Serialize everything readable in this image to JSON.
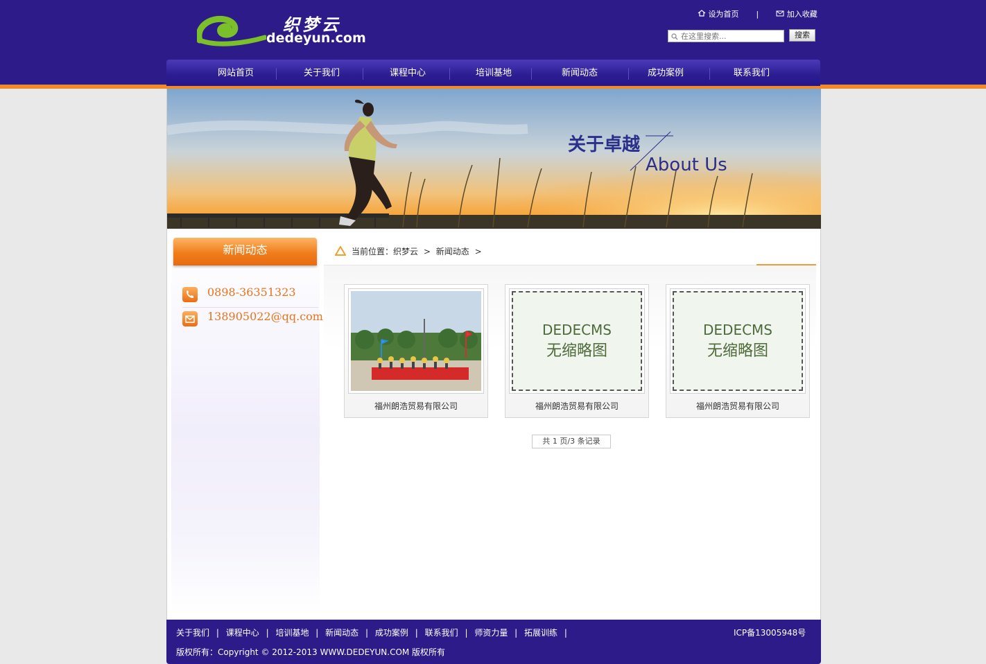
{
  "site": {
    "logo_cn": "织梦云",
    "logo_en": "dedeyun.com",
    "top_links": {
      "home": "设为首页",
      "separator": "|",
      "favorite": "加入收藏"
    },
    "search": {
      "placeholder": "在这里搜索...",
      "button": "搜索"
    }
  },
  "nav": [
    "网站首页",
    "关于我们",
    "课程中心",
    "培训基地",
    "新闻动态",
    "成功案例",
    "联系我们"
  ],
  "banner": {
    "title_cn": "关于卓越",
    "title_en": "About Us"
  },
  "sidebar": {
    "heading": "新闻动态",
    "phone": "0898-36351323",
    "email": "138905022@qq.com"
  },
  "breadcrumb": {
    "prefix": "当前位置：",
    "home": "织梦云",
    "arrow1": ">",
    "section": "新闻动态",
    "arrow2": ">"
  },
  "items": [
    {
      "title": "福州朗浩贸易有限公司",
      "thumb_type": "photo"
    },
    {
      "title": "福州朗浩贸易有限公司",
      "thumb_type": "placeholder",
      "placeholder_line1": "DEDECMS",
      "placeholder_line2": "无缩略图"
    },
    {
      "title": "福州朗浩贸易有限公司",
      "thumb_type": "placeholder",
      "placeholder_line1": "DEDECMS",
      "placeholder_line2": "无缩略图"
    }
  ],
  "pager": "共 1 页/3 条记录",
  "footer": {
    "links": [
      "关于我们",
      "课程中心",
      "培训基地",
      "新闻动态",
      "成功案例",
      "联系我们",
      "师资力量",
      "拓展训练"
    ],
    "link_sep": "|",
    "icp": "ICP备13005948号",
    "copyright": "版权所有：Copyright © 2012-2013 WWW.DEDEYUN.COM 版权所有"
  },
  "colors": {
    "brand_purple": "#2e1b8a",
    "accent_orange": "#f08a2a",
    "contact_orange": "#e8731a"
  }
}
